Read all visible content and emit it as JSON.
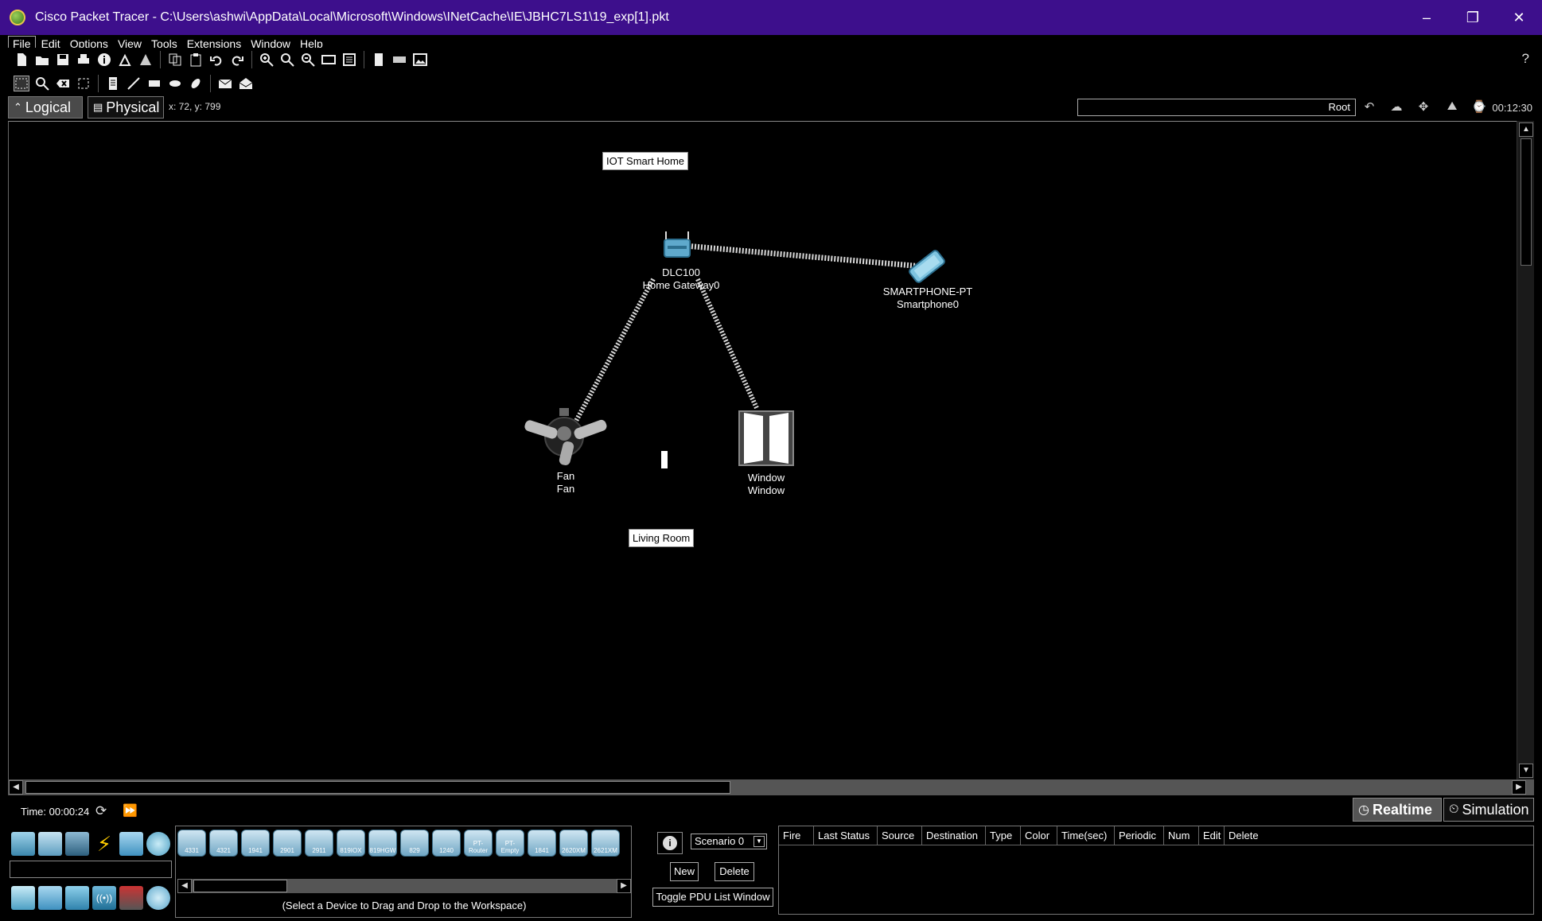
{
  "window": {
    "title": "Cisco Packet Tracer - C:\\Users\\ashwi\\AppData\\Local\\Microsoft\\Windows\\INetCache\\IE\\JBHC7LS1\\19_exp[1].pkt",
    "minimize": "–",
    "restore": "❐",
    "close": "✕"
  },
  "menu": [
    "File",
    "Edit",
    "Options",
    "View",
    "Tools",
    "Extensions",
    "Window",
    "Help"
  ],
  "help_label": "?",
  "view": {
    "logical_tab": "Logical",
    "physical_tab": "Physical",
    "coords": "x: 72, y: 799",
    "root_label": "Root",
    "clock": "00:12:30"
  },
  "workspace": {
    "notes": {
      "iot_home": "IOT Smart Home",
      "living_room": "Living Room"
    },
    "devices": {
      "gateway": {
        "model": "DLC100",
        "name": "Home Gateway0"
      },
      "smartphone": {
        "model": "SMARTPHONE-PT",
        "name": "Smartphone0"
      },
      "fan": {
        "model": "Fan",
        "name": "Fan"
      },
      "window": {
        "model": "Window",
        "name": "Window"
      }
    }
  },
  "bottom": {
    "time_label": "Time: 00:00:24",
    "realtime": "Realtime",
    "simulation": "Simulation",
    "device_models": [
      "4331",
      "4321",
      "1941",
      "2901",
      "2911",
      "819IOX",
      "819HGW",
      "829",
      "1240",
      "PT-Router",
      "PT-Empty",
      "1841",
      "2620XM",
      "2621XM"
    ],
    "hint": "(Select a Device to Drag and Drop to the Workspace)",
    "scenario": {
      "info": "i",
      "selected": "Scenario 0",
      "new_label": "New",
      "delete_label": "Delete",
      "toggle_label": "Toggle PDU List Window"
    },
    "pdu_columns": [
      "Fire",
      "Last Status",
      "Source",
      "Destination",
      "Type",
      "Color",
      "Time(sec)",
      "Periodic",
      "Num",
      "Edit",
      "Delete"
    ]
  },
  "colors": {
    "titlebar": "#3d0f8c",
    "background": "#000000",
    "device_blue": "#6fa6c4"
  }
}
